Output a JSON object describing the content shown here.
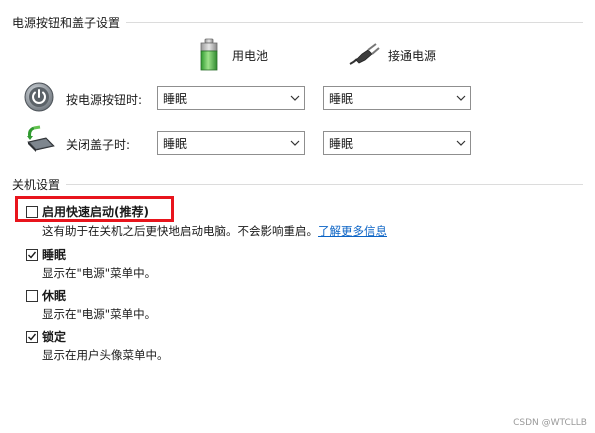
{
  "power_section": {
    "title": "电源按钮和盖子设置",
    "col_battery": "用电池",
    "col_plugged": "接通电源",
    "rows": [
      {
        "label": "按电源按钮时:",
        "battery_value": "睡眠",
        "plugged_value": "睡眠"
      },
      {
        "label": "关闭盖子时:",
        "battery_value": "睡眠",
        "plugged_value": "睡眠"
      }
    ]
  },
  "shutdown_section": {
    "title": "关机设置",
    "options": [
      {
        "label": "启用快速启动(推荐)",
        "checked": false,
        "desc": "这有助于在关机之后更快地启动电脑。不会影响重启。",
        "link": "了解更多信息"
      },
      {
        "label": "睡眠",
        "checked": true,
        "desc": "显示在\"电源\"菜单中。"
      },
      {
        "label": "休眠",
        "checked": false,
        "desc": "显示在\"电源\"菜单中。"
      },
      {
        "label": "锁定",
        "checked": true,
        "desc": "显示在用户头像菜单中。"
      }
    ]
  },
  "highlight_color": "#e8141c",
  "link_color": "#0b63c5",
  "watermark": "CSDN @WTCLLB"
}
